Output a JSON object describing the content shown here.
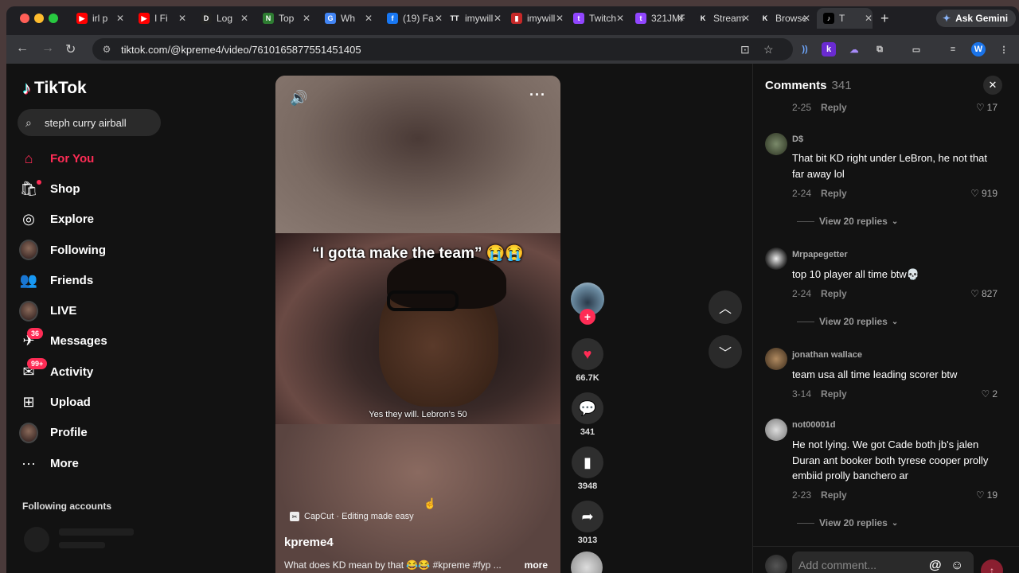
{
  "browser": {
    "tabs": [
      {
        "label": "irl p",
        "icon": "youtube-icon",
        "color": "#ff0000",
        "glyph": "▶"
      },
      {
        "label": "I Fi",
        "icon": "youtube-icon",
        "color": "#ff0000",
        "glyph": "▶"
      },
      {
        "label": "Log",
        "icon": "d2l-icon",
        "color": "#222222",
        "glyph": "D"
      },
      {
        "label": "Top",
        "icon": "graph-icon",
        "color": "#2e7d32",
        "glyph": "N"
      },
      {
        "label": "Wh",
        "icon": "google-icon",
        "color": "#4285f4",
        "glyph": "G"
      },
      {
        "label": "(19) Fa",
        "icon": "facebook-icon",
        "color": "#1877f2",
        "glyph": "f"
      },
      {
        "label": "imywill",
        "icon": "tt-icon",
        "color": "#1f1f23",
        "glyph": "TT"
      },
      {
        "label": "imywill",
        "icon": "chart-icon",
        "color": "#c62828",
        "glyph": "▮"
      },
      {
        "label": "Twitch",
        "icon": "twitch-icon",
        "color": "#9146ff",
        "glyph": "t"
      },
      {
        "label": "321JMF",
        "icon": "twitch-icon",
        "color": "#9146ff",
        "glyph": "t"
      },
      {
        "label": "Stream",
        "icon": "kick-icon",
        "color": "#1f1f23",
        "glyph": "K"
      },
      {
        "label": "Browse",
        "icon": "kick-icon",
        "color": "#1f1f23",
        "glyph": "K"
      },
      {
        "label": "T",
        "icon": "tiktok-icon",
        "color": "#000000",
        "glyph": "♪",
        "active": true
      }
    ],
    "new_tab": "+",
    "ask_gemini": "Ask Gemini",
    "url": "tiktok.com/@kpreme4/video/7610165877551451405",
    "profile_initial": "W",
    "ext_k": "k"
  },
  "sidebar": {
    "logo": "TikTok",
    "search_value": "steph curry airball",
    "items": [
      {
        "label": "For You",
        "icon": "home-icon",
        "glyph": "⌂",
        "active": true
      },
      {
        "label": "Shop",
        "icon": "shop-bag-icon",
        "glyph": "🛍"
      },
      {
        "label": "Explore",
        "icon": "compass-icon",
        "glyph": "◎"
      },
      {
        "label": "Following",
        "icon": "following-avatar-icon",
        "glyph": ""
      },
      {
        "label": "Friends",
        "icon": "friends-icon",
        "glyph": "👥"
      },
      {
        "label": "LIVE",
        "icon": "live-avatar-icon",
        "glyph": ""
      },
      {
        "label": "Messages",
        "icon": "messages-icon",
        "glyph": "✈",
        "badge": "36"
      },
      {
        "label": "Activity",
        "icon": "activity-icon",
        "glyph": "✉",
        "badge": "99+"
      },
      {
        "label": "Upload",
        "icon": "upload-icon",
        "glyph": "⊞"
      },
      {
        "label": "Profile",
        "icon": "profile-avatar-icon",
        "glyph": ""
      },
      {
        "label": "More",
        "icon": "more-dots-icon",
        "glyph": "···"
      }
    ],
    "following_accounts": "Following accounts"
  },
  "video": {
    "caption_big": "“I gotta make the team” 😭😭",
    "caption_small": "Yes they will. Lebron's 50",
    "capcut": "CapCut · Editing made easy",
    "author": "kpreme4",
    "description": "What does KD mean by that 😂😂 #kpreme #fyp ...",
    "more": "more"
  },
  "actions": {
    "likes": "66.7K",
    "comments": "341",
    "saves": "3948",
    "shares": "3013"
  },
  "comments": {
    "title": "Comments",
    "count": "341",
    "top_meta": {
      "date": "2-25",
      "reply": "Reply",
      "likes": "17"
    },
    "items": [
      {
        "user": "D$",
        "text": "That bit KD right under LeBron, he not that far away lol",
        "date": "2-24",
        "reply": "Reply",
        "likes": "919",
        "view_replies": "View 20 replies"
      },
      {
        "user": "Mrpapegetter",
        "text": "top 10 player all time btw💀",
        "date": "2-24",
        "reply": "Reply",
        "likes": "827",
        "view_replies": "View 20 replies"
      },
      {
        "user": "jonathan wallace",
        "text": "team usa all time leading scorer btw",
        "date": "3-14",
        "reply": "Reply",
        "likes": "2"
      },
      {
        "user": "not00001d",
        "text": "He not lying. We got Cade both jb's jalen Duran ant booker both tyrese cooper prolly embiid prolly banchero ar",
        "date": "2-23",
        "reply": "Reply",
        "likes": "19",
        "view_replies": "View 20 replies"
      }
    ],
    "input_placeholder": "Add comment..."
  }
}
